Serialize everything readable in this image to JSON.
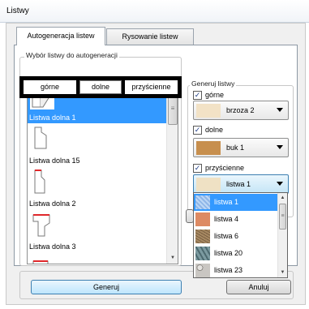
{
  "window": {
    "title": "Listwy"
  },
  "tabs": [
    {
      "label": "Autogeneracja listew"
    },
    {
      "label": "Rysowanie listew"
    }
  ],
  "selection_group": {
    "label": "Wybór listwy do autogeneracji",
    "segments": [
      {
        "label": "górne"
      },
      {
        "label": "dolne"
      },
      {
        "label": "przyścienne"
      }
    ]
  },
  "list": {
    "items": [
      {
        "label": "Listwa dolna 1",
        "selected": true
      },
      {
        "label": "Listwa dolna 15",
        "selected": false
      },
      {
        "label": "Listwa dolna 2",
        "selected": false
      },
      {
        "label": "Listwa dolna 3",
        "selected": false
      },
      {
        "label": "",
        "selected": false
      }
    ]
  },
  "generate_group": {
    "label": "Generuj listwy",
    "rows": [
      {
        "check_label": "górne",
        "checked": true,
        "value": "brzoza 2",
        "swatch": "#f2e2c6"
      },
      {
        "check_label": "dolne",
        "checked": true,
        "value": "buk 1",
        "swatch": "#c78f4e"
      },
      {
        "check_label": "przyścienne",
        "checked": true,
        "value": "listwa 1",
        "swatch": "#efe1c4"
      }
    ]
  },
  "dropdown": {
    "options": [
      {
        "label": "listwa 1",
        "swatch": "#a8c9f0",
        "selected": true
      },
      {
        "label": "listwa 4",
        "swatch": "#dd8a63",
        "selected": false
      },
      {
        "label": "listwa 6",
        "swatch": "#a78962",
        "selected": false
      },
      {
        "label": "listwa 20",
        "swatch": "#7b9aa0",
        "selected": false
      },
      {
        "label": "listwa 23",
        "swatch": "#c9c6c2",
        "selected": false
      },
      {
        "label": "",
        "swatch": "#b48a5e",
        "selected": false
      }
    ]
  },
  "buttons": {
    "generate": "Generuj",
    "cancel": "Anuluj"
  },
  "icons": {
    "check": "✓",
    "scroll_up": "▲",
    "scroll_down": "▼",
    "thumb_grip": "≡"
  },
  "colors": {
    "selection": "#3399ff",
    "profile_red": "#e0282b"
  }
}
